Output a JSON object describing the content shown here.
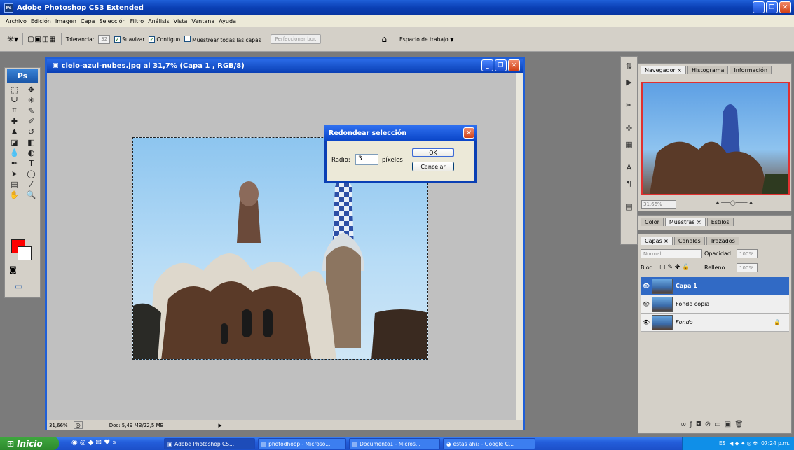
{
  "app": {
    "title": "Adobe Photoshop CS3 Extended",
    "badge": "Ps"
  },
  "window_buttons": [
    "_",
    "❐",
    "✕"
  ],
  "menu": [
    "Archivo",
    "Edición",
    "Imagen",
    "Capa",
    "Selección",
    "Filtro",
    "Análisis",
    "Vista",
    "Ventana",
    "Ayuda"
  ],
  "options": {
    "tolerance_label": "Tolerancia:",
    "tolerance_value": "32",
    "antialias_label": "Suavizar",
    "contiguous_label": "Contiguo",
    "sample_all_label": "Muestrear todas las capas",
    "refine_label": "Perfeccionar bor.",
    "workspace_label": "Espacio de trabajo ▼"
  },
  "tools": {
    "logo": "Ps"
  },
  "document": {
    "title": "cielo-azul-nubes.jpg al 31,7% (Capa 1 , RGB/8)",
    "zoom": "31,66%",
    "doc_info": "Doc: 5,49 MB/22,5 MB"
  },
  "dialog": {
    "title": "Redondear selección",
    "radius_label": "Radio:",
    "radius_value": "3",
    "unit_label": "píxeles",
    "ok_label": "OK",
    "cancel_label": "Cancelar"
  },
  "navigator": {
    "tabs": [
      "Navegador ×",
      "Histograma",
      "Información"
    ],
    "zoom": "31,66%"
  },
  "swatches": {
    "tabs": [
      "Color",
      "Muestras ×",
      "Estilos"
    ]
  },
  "layers_panel": {
    "tabs": [
      "Capas ×",
      "Canales",
      "Trazados"
    ],
    "blend_mode": "Normal",
    "opacity_label": "Opacidad:",
    "opacity_value": "100%",
    "lock_label": "Bloq.:",
    "fill_label": "Relleno:",
    "fill_value": "100%",
    "layers": [
      {
        "name": "Capa 1",
        "selected": true
      },
      {
        "name": "Fondo copia",
        "selected": false
      },
      {
        "name": "Fondo",
        "selected": false
      }
    ]
  },
  "taskbar": {
    "start_label": "Inicio",
    "items": [
      "Adobe Photoshop CS...",
      "photodhoop - Microso...",
      "Documento1 - Micros...",
      "estas ahi? - Google C..."
    ],
    "lang": "ES",
    "clock": "07:24 p.m."
  }
}
